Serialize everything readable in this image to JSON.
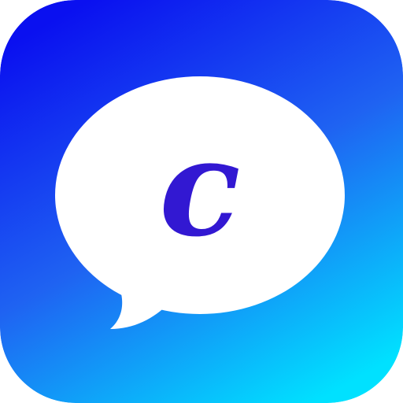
{
  "icon": {
    "letter": "c",
    "icon_name": "chat-bubble-icon",
    "colors": {
      "gradient_start": "#0a10f0",
      "gradient_mid": "#1f63f2",
      "gradient_end": "#00e1ff",
      "bubble": "#ffffff",
      "letter": "#3218d2"
    }
  }
}
